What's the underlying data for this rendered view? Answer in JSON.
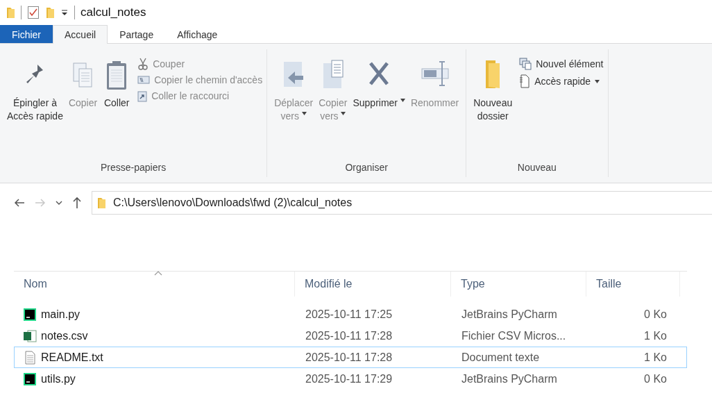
{
  "window": {
    "title": "calcul_notes"
  },
  "tabs": [
    {
      "label": "Fichier",
      "kind": "menu",
      "selected": false
    },
    {
      "label": "Accueil",
      "kind": "tab",
      "selected": true
    },
    {
      "label": "Partage",
      "kind": "tab",
      "selected": false
    },
    {
      "label": "Affichage",
      "kind": "tab",
      "selected": false
    }
  ],
  "ribbon": {
    "groups": [
      {
        "label": "Presse-papiers",
        "large": [
          {
            "label": "Épingler à\nAccès rapide",
            "disabled": false,
            "dropdown": false
          },
          {
            "label": "Copier",
            "disabled": true,
            "dropdown": false
          },
          {
            "label": "Coller",
            "disabled": false,
            "dropdown": false
          }
        ],
        "small": [
          {
            "label": "Couper",
            "disabled": true,
            "dropdown": false
          },
          {
            "label": "Copier le chemin d'accès",
            "disabled": true,
            "dropdown": false
          },
          {
            "label": "Coller le raccourci",
            "disabled": true,
            "dropdown": false
          }
        ]
      },
      {
        "label": "Organiser",
        "large": [
          {
            "label": "Déplacer\nvers",
            "disabled": true,
            "dropdown": true
          },
          {
            "label": "Copier\nvers",
            "disabled": true,
            "dropdown": true
          },
          {
            "label": "Supprimer",
            "disabled": false,
            "dropdown": true
          },
          {
            "label": "Renommer",
            "disabled": true,
            "dropdown": false
          }
        ]
      },
      {
        "label": "Nouveau",
        "large": [
          {
            "label": "Nouveau\ndossier",
            "disabled": false,
            "dropdown": false
          }
        ],
        "small": [
          {
            "label": "Nouvel élément",
            "disabled": false,
            "dropdown": false
          },
          {
            "label": "Accès rapide",
            "disabled": false,
            "dropdown": true
          }
        ]
      }
    ]
  },
  "navigation": {
    "back_disabled": false,
    "forward_disabled": true,
    "path": "C:\\Users\\lenovo\\Downloads\\fwd (2)\\calcul_notes"
  },
  "table": {
    "columns": [
      {
        "label": "Nom",
        "sorted": true
      },
      {
        "label": "Modifié le",
        "sorted": false
      },
      {
        "label": "Type",
        "sorted": false
      },
      {
        "label": "Taille",
        "sorted": false
      }
    ],
    "rows": [
      {
        "kind": "pycharm",
        "name": "main.py",
        "modified": "2025-10-11 17:25",
        "type": "JetBrains PyCharm",
        "size": "0 Ko",
        "focused": false
      },
      {
        "kind": "spreadsheet",
        "name": "notes.csv",
        "modified": "2025-10-11 17:28",
        "type": "Fichier CSV Micros...",
        "size": "1 Ko",
        "focused": false
      },
      {
        "kind": "text",
        "name": "README.txt",
        "modified": "2025-10-11 17:28",
        "type": "Document texte",
        "size": "1 Ko",
        "focused": true
      },
      {
        "kind": "pycharm",
        "name": "utils.py",
        "modified": "2025-10-11 17:29",
        "type": "JetBrains PyCharm",
        "size": "0 Ko",
        "focused": false
      }
    ]
  }
}
